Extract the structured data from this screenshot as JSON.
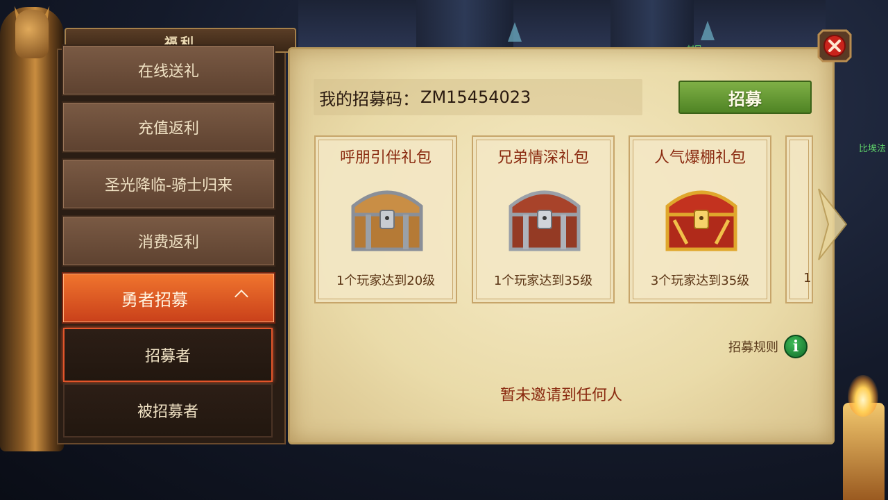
{
  "menu": {
    "title": "福利",
    "items": [
      {
        "label": "在线送礼"
      },
      {
        "label": "充值返利"
      },
      {
        "label": "圣光降临-骑士归来"
      },
      {
        "label": "消费返利"
      },
      {
        "label": "勇者招募"
      }
    ],
    "sub_items": [
      {
        "label": "招募者"
      },
      {
        "label": "被招募者"
      }
    ]
  },
  "recruit": {
    "code_label": "我的招募码：",
    "code_value": "ZM15454023",
    "button_label": "招募"
  },
  "packs": [
    {
      "title": "呼朋引伴礼包",
      "desc": "1个玩家达到20级",
      "chest": "silver-wood-chest"
    },
    {
      "title": "兄弟情深礼包",
      "desc": "1个玩家达到35级",
      "chest": "silver-red-chest"
    },
    {
      "title": "人气爆棚礼包",
      "desc": "3个玩家达到35级",
      "chest": "gold-red-chest"
    },
    {
      "title": "",
      "desc": "1",
      "chest": ""
    }
  ],
  "rules_label": "招募规则",
  "empty_message": "暂未邀请到任何人",
  "bg_side_text": "比埃法",
  "bg_top_text": "村民",
  "colors": {
    "active_tab": "#e35a22",
    "recruit_button": "#6a9d36",
    "parchment": "#efe2b6",
    "card_title": "#8a2a10"
  }
}
